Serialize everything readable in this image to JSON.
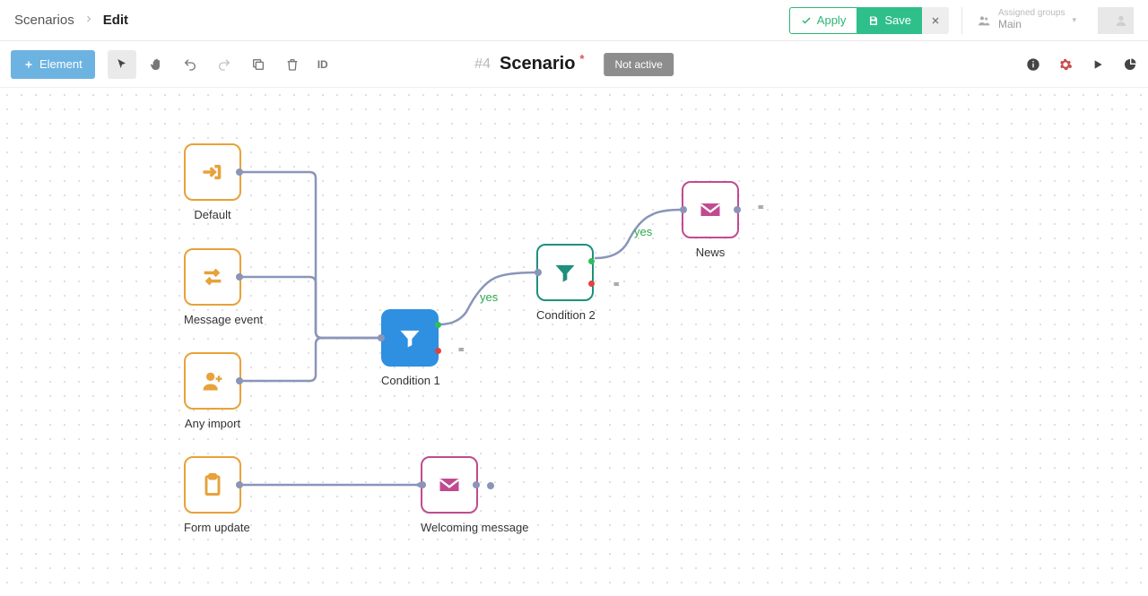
{
  "breadcrumb": {
    "root": "Scenarios",
    "current": "Edit"
  },
  "header": {
    "apply": "Apply",
    "save": "Save",
    "assigned_label": "Assigned groups",
    "assigned_value": "Main"
  },
  "toolbar": {
    "element": "Element",
    "tool_id": "ID",
    "scenario_number": "#4",
    "scenario_name": "Scenario",
    "status": "Not active"
  },
  "nodes": {
    "default": "Default",
    "message_event": "Message event",
    "any_import": "Any import",
    "condition1": "Condition 1",
    "condition2": "Condition 2",
    "news": "News",
    "form_update": "Form update",
    "welcoming": "Welcoming message"
  },
  "labels": {
    "yes": "yes"
  }
}
